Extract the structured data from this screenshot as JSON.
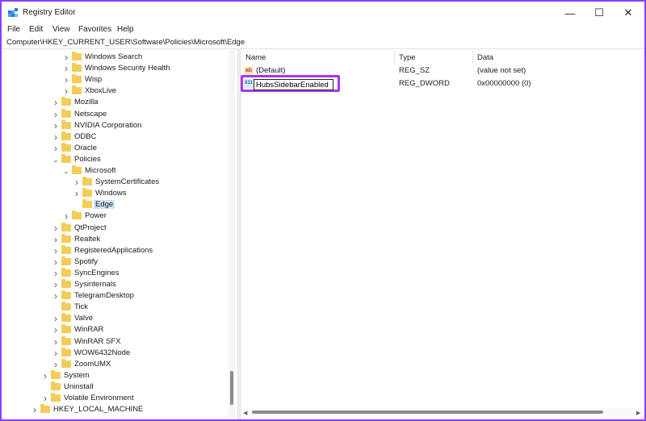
{
  "window": {
    "title": "Registry Editor",
    "controls": {
      "minimize": "—",
      "maximize": "☐",
      "close": "✕"
    }
  },
  "menu": [
    "File",
    "Edit",
    "View",
    "Favorites",
    "Help"
  ],
  "address": "Computer\\HKEY_CURRENT_USER\\Software\\Policies\\Microsoft\\Edge",
  "tree": [
    {
      "label": "Windows Search",
      "depth": 3,
      "expander": ">"
    },
    {
      "label": "Windows Security Health",
      "depth": 3,
      "expander": ">"
    },
    {
      "label": "Wisp",
      "depth": 3,
      "expander": ">"
    },
    {
      "label": "XboxLive",
      "depth": 3,
      "expander": ">"
    },
    {
      "label": "Mozilla",
      "depth": 2,
      "expander": ">"
    },
    {
      "label": "Netscape",
      "depth": 2,
      "expander": ">"
    },
    {
      "label": "NVIDIA Corporation",
      "depth": 2,
      "expander": ">"
    },
    {
      "label": "ODBC",
      "depth": 2,
      "expander": ">"
    },
    {
      "label": "Oracle",
      "depth": 2,
      "expander": ">"
    },
    {
      "label": "Policies",
      "depth": 2,
      "expander": "v"
    },
    {
      "label": "Microsoft",
      "depth": 3,
      "expander": "v"
    },
    {
      "label": "SystemCertificates",
      "depth": 4,
      "expander": ">"
    },
    {
      "label": "Windows",
      "depth": 4,
      "expander": ">"
    },
    {
      "label": "Edge",
      "depth": 4,
      "expander": "",
      "selected": true
    },
    {
      "label": "Power",
      "depth": 3,
      "expander": ">"
    },
    {
      "label": "QtProject",
      "depth": 2,
      "expander": ">"
    },
    {
      "label": "Realtek",
      "depth": 2,
      "expander": ">"
    },
    {
      "label": "RegisteredApplications",
      "depth": 2,
      "expander": ">"
    },
    {
      "label": "Spotify",
      "depth": 2,
      "expander": ">"
    },
    {
      "label": "SyncEngines",
      "depth": 2,
      "expander": ">"
    },
    {
      "label": "Sysinternals",
      "depth": 2,
      "expander": ">"
    },
    {
      "label": "TelegramDesktop",
      "depth": 2,
      "expander": ">"
    },
    {
      "label": "Tick",
      "depth": 2,
      "expander": ""
    },
    {
      "label": "Valve",
      "depth": 2,
      "expander": ">"
    },
    {
      "label": "WinRAR",
      "depth": 2,
      "expander": ">"
    },
    {
      "label": "WinRAR SFX",
      "depth": 2,
      "expander": ">"
    },
    {
      "label": "WOW6432Node",
      "depth": 2,
      "expander": ">"
    },
    {
      "label": "ZoomUMX",
      "depth": 2,
      "expander": ">"
    },
    {
      "label": "System",
      "depth": 1,
      "expander": ">"
    },
    {
      "label": "Uninstall",
      "depth": 1,
      "expander": ""
    },
    {
      "label": "Volatile Environment",
      "depth": 1,
      "expander": ">"
    },
    {
      "label": "HKEY_LOCAL_MACHINE",
      "depth": 0,
      "expander": ">"
    }
  ],
  "values": {
    "columns": [
      "Name",
      "Type",
      "Data"
    ],
    "rows": [
      {
        "icon": "ab",
        "name": "(Default)",
        "type": "REG_SZ",
        "data": "(value not set)"
      },
      {
        "icon": "011",
        "name": "HubsSidebarEnabled",
        "type": "REG_DWORD",
        "data": "0x00000000 (0)",
        "editing": true
      }
    ]
  },
  "colors": {
    "accent_border": "#8a3ffc",
    "highlight_box": "#a638e6",
    "folder": "#f4cd59",
    "selection": "#cce4f7"
  }
}
